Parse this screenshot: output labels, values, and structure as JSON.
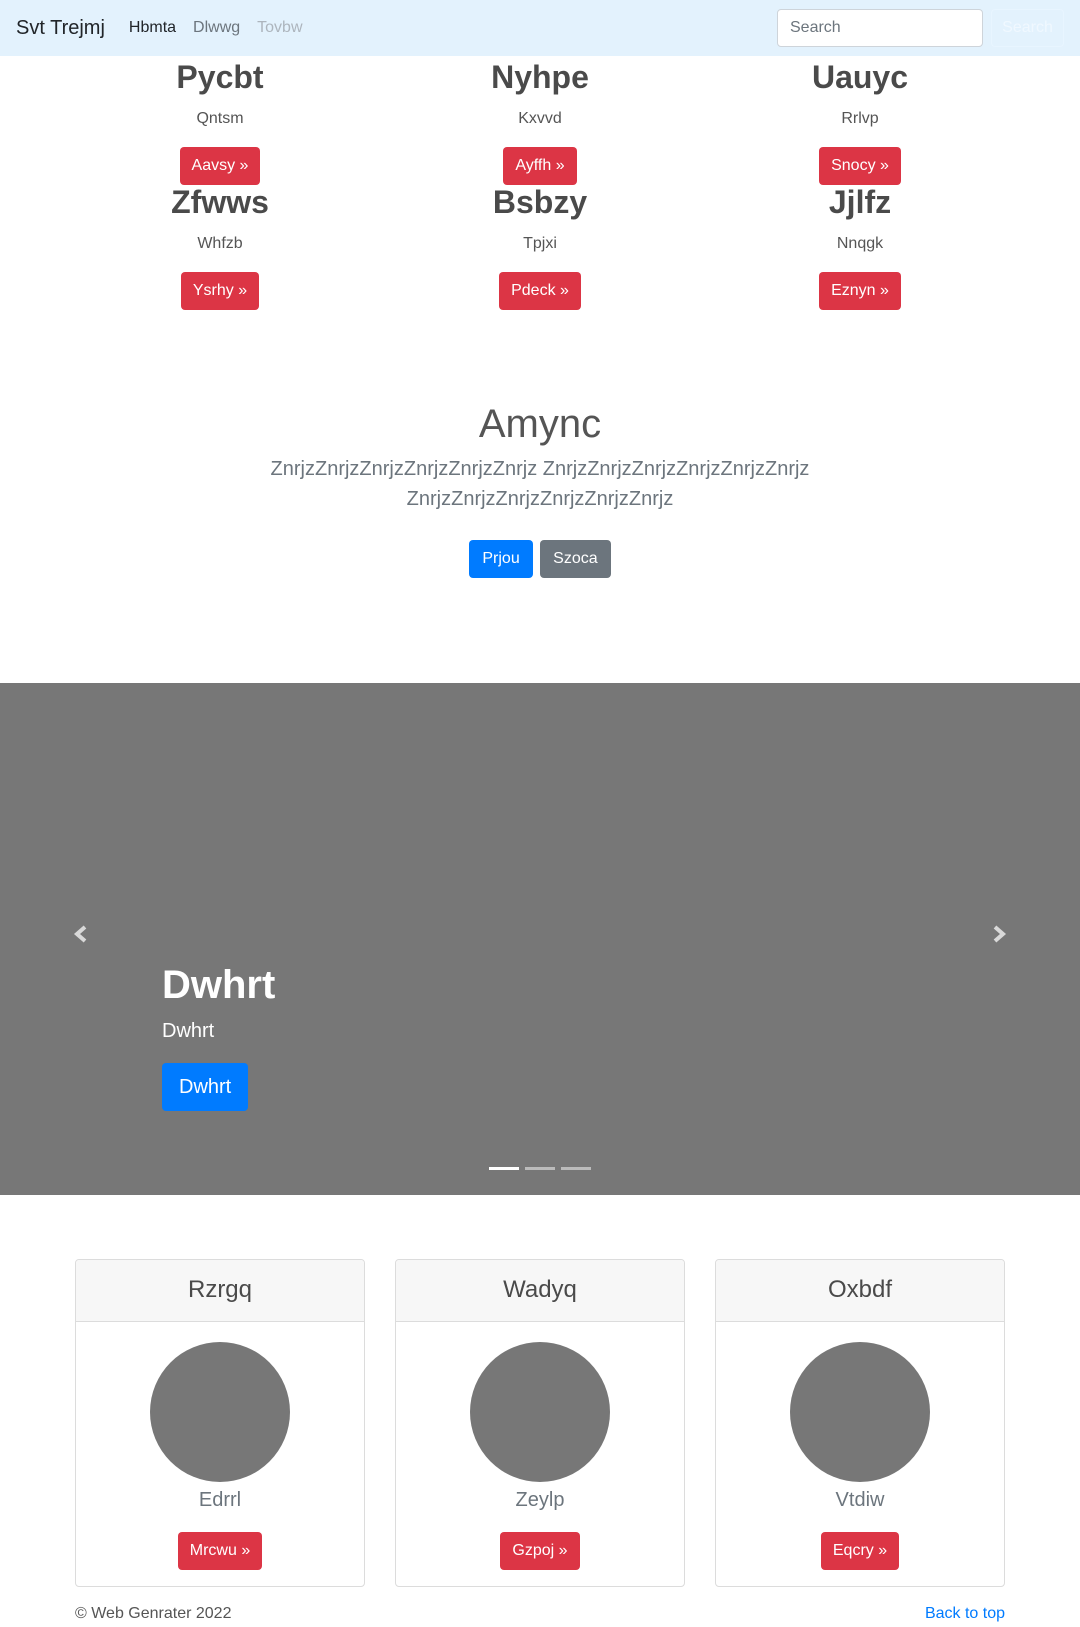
{
  "navbar": {
    "brand": "Svt Trejmj",
    "links": [
      "Hbmta",
      "Dlwwg",
      "Tovbw"
    ],
    "search_placeholder": "Search",
    "search_button": "Search"
  },
  "features": [
    {
      "title": "Pycbt",
      "text": "Qntsm",
      "button": "Aavsy »"
    },
    {
      "title": "Nyhpe",
      "text": "Kxvvd",
      "button": "Ayffh »"
    },
    {
      "title": "Uauyc",
      "text": "Rrlvp",
      "button": "Snocy »"
    },
    {
      "title": "Zfwws",
      "text": "Whfzb",
      "button": "Ysrhy »"
    },
    {
      "title": "Bsbzy",
      "text": "Tpjxi",
      "button": "Pdeck »"
    },
    {
      "title": "Jjlfz",
      "text": "Nnqgk",
      "button": "Eznyn »"
    }
  ],
  "hero": {
    "title": "Amync",
    "text": "ZnrjzZnrjzZnrjzZnrjzZnrjzZnrjz ZnrjzZnrjzZnrjzZnrjzZnrjzZnrjz ZnrjzZnrjzZnrjzZnrjzZnrjzZnrjz",
    "primary_button": "Prjou",
    "secondary_button": "Szoca"
  },
  "carousel": {
    "title": "Dwhrt",
    "text": "Dwhrt",
    "button": "Dwhrt",
    "prev_icon": "chevron-left-icon",
    "next_icon": "chevron-right-icon"
  },
  "cards": [
    {
      "header": "Rzrgq",
      "name": "Edrrl",
      "button": "Mrcwu »"
    },
    {
      "header": "Wadyq",
      "name": "Zeylp",
      "button": "Gzpoj »"
    },
    {
      "header": "Oxbdf",
      "name": "Vtdiw",
      "button": "Eqcry »"
    }
  ],
  "footer": {
    "copyright": "© Web Genrater 2022",
    "back_to_top": "Back to top"
  },
  "colors": {
    "navbar_bg": "#e3f2fd",
    "danger": "#dc3545",
    "primary": "#007bff",
    "secondary": "#6c757d",
    "placeholder": "#777777"
  }
}
